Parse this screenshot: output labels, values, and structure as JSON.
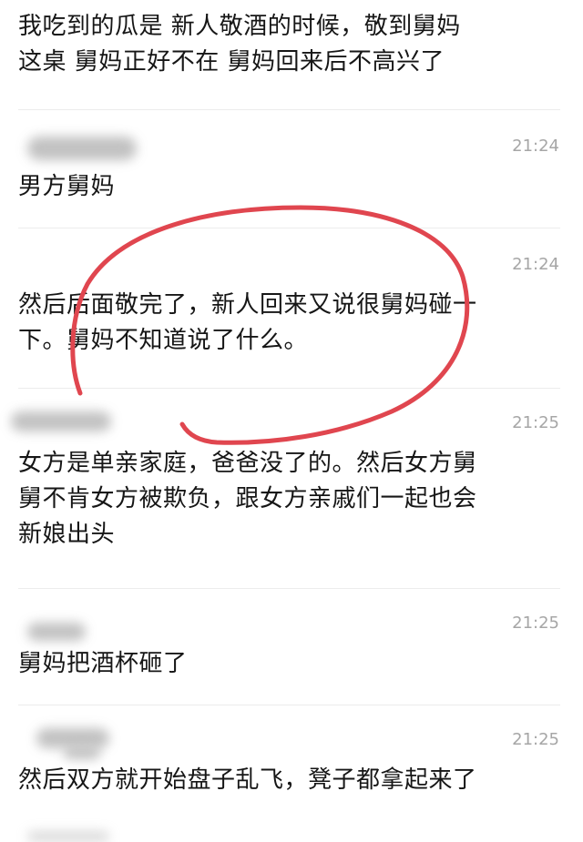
{
  "messages": [
    {
      "text": "我吃到的瓜是 新人敬酒的时候，敬到舅妈\n这桌 舅妈正好不在 舅妈回来后不高兴了",
      "time": ""
    },
    {
      "text": "男方舅妈",
      "time": "21:24"
    },
    {
      "text": "然后后面敬完了，新人回来又说很舅妈碰一\n下。舅妈不知道说了什么。",
      "time": "21:24"
    },
    {
      "text": "女方是单亲家庭，爸爸没了的。然后女方舅\n舅不肯女方被欺负，跟女方亲戚们一起也会\n新娘出头",
      "time": "21:25"
    },
    {
      "text": "舅妈把酒杯砸了",
      "time": "21:25"
    },
    {
      "text": "然后双方就开始盘子乱飞，凳子都拿起来了",
      "time": "21:25"
    }
  ],
  "colors": {
    "text": "#161616",
    "time": "#a6a6a6",
    "divider": "#ececec",
    "annotation": "#e0464f"
  }
}
